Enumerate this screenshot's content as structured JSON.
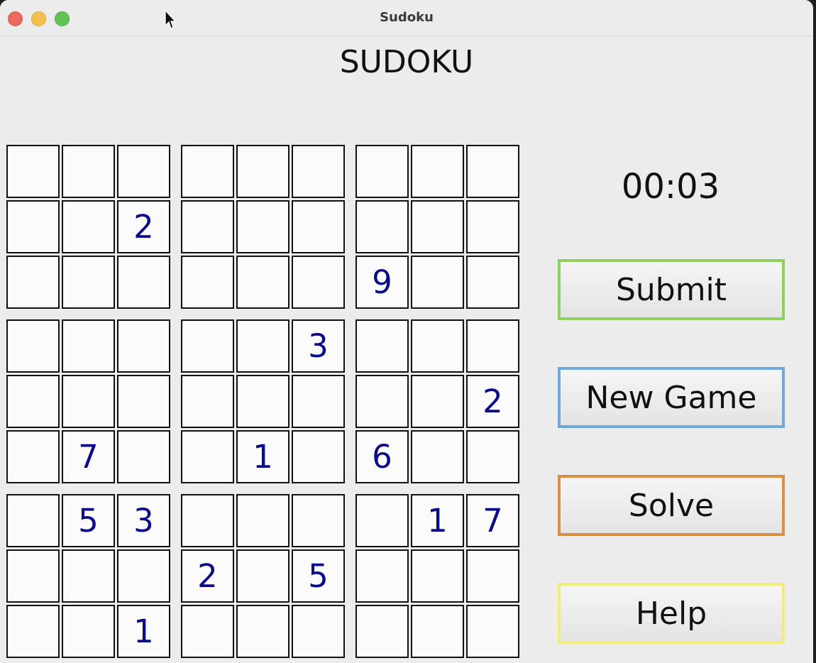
{
  "window": {
    "title": "Sudoku"
  },
  "heading": "SUDOKU",
  "timer": "00:03",
  "buttons": [
    {
      "label": "Submit",
      "name": "submit-button",
      "border": "#8fd160"
    },
    {
      "label": "New Game",
      "name": "new-game-button",
      "border": "#70a8dc"
    },
    {
      "label": "Solve",
      "name": "solve-button",
      "border": "#d79044"
    },
    {
      "label": "Help",
      "name": "help-button",
      "border": "#f2ec7a"
    }
  ],
  "colors": {
    "given_digit": "#0b0b8a",
    "grid_line": "#111111",
    "window_bg": "#ececec"
  },
  "grid": [
    [
      "",
      "",
      "",
      "",
      "",
      "",
      "",
      "",
      ""
    ],
    [
      "",
      "",
      "2",
      "",
      "",
      "",
      "",
      "",
      ""
    ],
    [
      "",
      "",
      "",
      "",
      "",
      "",
      "9",
      "",
      ""
    ],
    [
      "",
      "",
      "",
      "",
      "",
      "3",
      "",
      "",
      ""
    ],
    [
      "",
      "",
      "",
      "",
      "",
      "",
      "",
      "",
      "2"
    ],
    [
      "",
      "7",
      "",
      "",
      "1",
      "",
      "6",
      "",
      ""
    ],
    [
      "",
      "5",
      "3",
      "",
      "",
      "",
      "",
      "1",
      "7"
    ],
    [
      "",
      "",
      "",
      "2",
      "",
      "5",
      "",
      "",
      ""
    ],
    [
      "",
      "",
      "1",
      "",
      "",
      "",
      "",
      "",
      ""
    ]
  ]
}
